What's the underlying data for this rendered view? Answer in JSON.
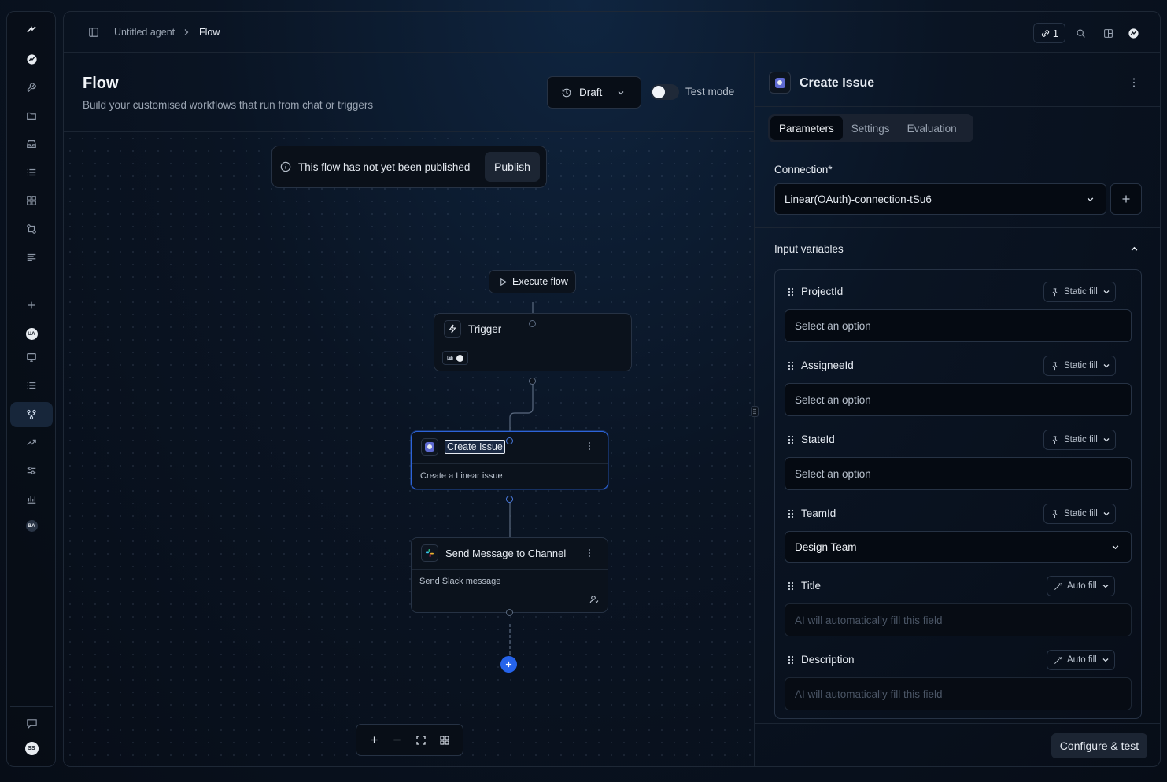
{
  "breadcrumb": {
    "agent": "Untitled agent",
    "current": "Flow"
  },
  "topbar": {
    "connections_count": "1"
  },
  "rail": {
    "avatar_ua": "UA",
    "avatar_ba": "BA",
    "avatar_ss": "SS",
    "icons": [
      "logo-icon",
      "route-icon",
      "wrench-icon",
      "folder-icon",
      "inbox-icon",
      "list-icon",
      "grid-icon",
      "git-compare-icon",
      "text-align-icon",
      "plus-icon",
      "avatar-ua",
      "monitor-icon",
      "list-icon",
      "flow-icon",
      "trending-icon",
      "sliders-icon",
      "bar-chart-icon",
      "avatar-ba",
      "chat-icon",
      "avatar-ss"
    ]
  },
  "flow": {
    "title": "Flow",
    "subtitle": "Build your customised workflows that run from chat or triggers",
    "draft_label": "Draft",
    "test_mode_label": "Test mode",
    "test_mode_on": false,
    "publish_notice": "This flow has not yet been published",
    "publish_label": "Publish",
    "execute_label": "Execute flow",
    "nodes": {
      "trigger": {
        "label": "Trigger"
      },
      "create_issue": {
        "label": "Create Issue",
        "description": "Create a Linear issue"
      },
      "send_message": {
        "label": "Send Message to Channel",
        "description": "Send Slack message"
      }
    }
  },
  "panel": {
    "title": "Create Issue",
    "tabs": [
      {
        "label": "Parameters",
        "active": true
      },
      {
        "label": "Settings",
        "active": false
      },
      {
        "label": "Evaluation",
        "active": false
      }
    ],
    "connection_label": "Connection*",
    "connection_value": "Linear(OAuth)-connection-tSu6",
    "input_variables_label": "Input variables",
    "variables": [
      {
        "name": "ProjectId",
        "mode": "Static fill",
        "value": "Select an option"
      },
      {
        "name": "AssigneeId",
        "mode": "Static fill",
        "value": "Select an option"
      },
      {
        "name": "StateId",
        "mode": "Static fill",
        "value": "Select an option"
      },
      {
        "name": "TeamId",
        "mode": "Static fill",
        "value": "Design Team"
      },
      {
        "name": "Title",
        "mode": "Auto fill",
        "value": "AI will automatically fill this field"
      },
      {
        "name": "Description",
        "mode": "Auto fill",
        "value": "AI will automatically fill this field"
      }
    ],
    "configure_label": "Configure & test"
  },
  "colors": {
    "accent": "#2563eb",
    "selected_border": "#2d63d8",
    "background": "#0a1423"
  }
}
